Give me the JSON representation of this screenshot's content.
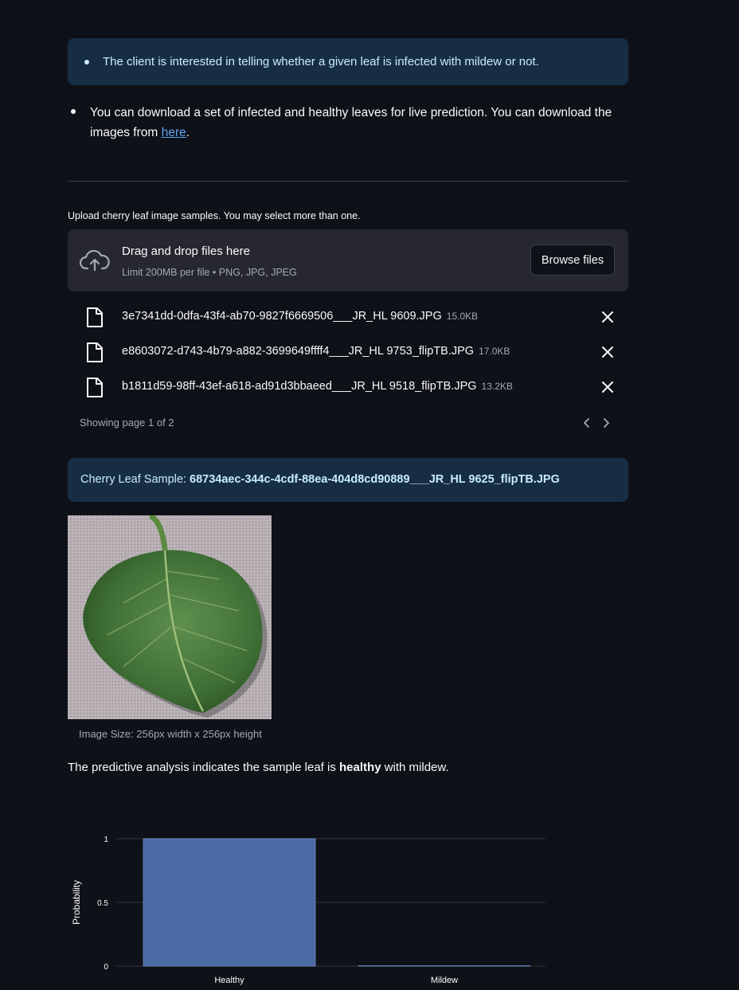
{
  "info": {
    "text": "The client is interested in telling whether a given leaf is infected with mildew or not."
  },
  "download": {
    "text_before": "You can download a set of infected and healthy leaves for live prediction. You can download the images from ",
    "link_text": "here",
    "text_after": "."
  },
  "uploader": {
    "label": "Upload cherry leaf image samples. You may select more than one.",
    "drop_title": "Drag and drop files here",
    "drop_subtitle": "Limit 200MB per file • PNG, JPG, JPEG",
    "browse_label": "Browse files",
    "files": [
      {
        "name": "3e7341dd-0dfa-43f4-ab70-9827f6669506___JR_HL 9609.JPG",
        "size": "15.0KB"
      },
      {
        "name": "e8603072-d743-4b79-a882-3699649ffff4___JR_HL 9753_flipTB.JPG",
        "size": "17.0KB"
      },
      {
        "name": "b1811d59-98ff-43ef-a618-ad91d3bbaeed___JR_HL 9518_flipTB.JPG",
        "size": "13.2KB"
      }
    ],
    "pager_text": "Showing page 1 of 2"
  },
  "sample": {
    "prefix": "Cherry Leaf Sample: ",
    "filename": "68734aec-344c-4cdf-88ea-404d8cd90889___JR_HL 9625_flipTB.JPG",
    "caption": "Image Size: 256px width x 256px height"
  },
  "result": {
    "prefix": "The predictive analysis indicates the sample leaf is ",
    "label": "healthy",
    "suffix": " with mildew."
  },
  "colors": {
    "background": "#0e1117",
    "info_bg": "#172d43",
    "info_text": "#c7ebff",
    "bar": "#4c6aa6"
  },
  "chart_data": {
    "type": "bar",
    "categories": [
      "Healthy",
      "Mildew"
    ],
    "values": [
      1,
      0.003
    ],
    "ylabel": "Probability",
    "xlabel": "",
    "yticks": [
      "0",
      "0.5",
      "1"
    ],
    "ylim": [
      0,
      1
    ],
    "grid": true
  }
}
